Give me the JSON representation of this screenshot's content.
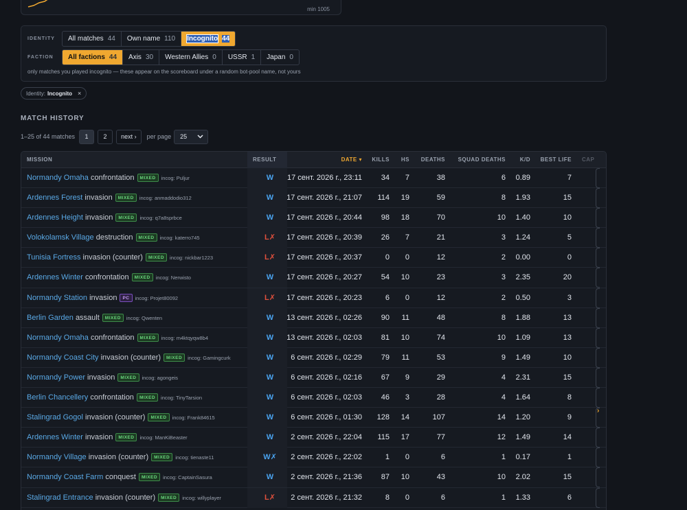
{
  "chart_card": {
    "min_label": "min 1005"
  },
  "filters": {
    "identity_label": "IDENTITY",
    "identity": [
      {
        "label": "All matches",
        "count": "44",
        "state": "normal"
      },
      {
        "label": "Own name",
        "count": "110",
        "state": "normal"
      },
      {
        "label": "Incognito",
        "count": "44",
        "state": "active"
      }
    ],
    "faction_label": "FACTION",
    "faction": [
      {
        "label": "All factions",
        "count": "44",
        "state": "active"
      },
      {
        "label": "Axis",
        "count": "30",
        "state": "normal"
      },
      {
        "label": "Western Allies",
        "count": "0",
        "state": "normal"
      },
      {
        "label": "USSR",
        "count": "1",
        "state": "normal"
      },
      {
        "label": "Japan",
        "count": "0",
        "state": "normal"
      }
    ],
    "note": "only matches you played incognito — these appear on the scoreboard under a random bot-pool name, not yours"
  },
  "chip": {
    "prefix": "Identity:",
    "value": "Incognito",
    "close": "×"
  },
  "history": {
    "title": "MATCH HISTORY",
    "count": "1–25 of 44 matches",
    "pages": [
      "1",
      "2"
    ],
    "next": "next ›",
    "per_page_label": "per page",
    "per_page_value": "25"
  },
  "table": {
    "headers": {
      "mission": "MISSION",
      "result": "RESULT",
      "date": "DATE ▾",
      "kills": "KILLS",
      "hs": "HS",
      "deaths": "DEATHS",
      "squad_deaths": "SQUAD DEATHS",
      "kd": "K/D",
      "best_life": "BEST LIFE",
      "cap": "CAP"
    },
    "rows": [
      {
        "map": "Normandy Omaha",
        "mode": "confrontation",
        "badge": "MIXED",
        "incog": "incog: Puljur",
        "result": "W",
        "date": "17 сент. 2026 г., 23:11",
        "kills": "34",
        "hs": "7",
        "deaths": "38",
        "squad": "6",
        "kd": "0.89",
        "best": "7"
      },
      {
        "map": "Ardennes Forest",
        "mode": "invasion",
        "badge": "MIXED",
        "incog": "incog: anmaddodio312",
        "result": "W",
        "date": "17 сент. 2026 г., 21:07",
        "kills": "114",
        "hs": "19",
        "deaths": "59",
        "squad": "8",
        "kd": "1.93",
        "best": "15"
      },
      {
        "map": "Ardennes Height",
        "mode": "invasion",
        "badge": "MIXED",
        "incog": "incog: q7a8sprbce",
        "result": "W",
        "date": "17 сент. 2026 г., 20:44",
        "kills": "98",
        "hs": "18",
        "deaths": "70",
        "squad": "10",
        "kd": "1.40",
        "best": "10"
      },
      {
        "map": "Volokolamsk Village",
        "mode": "destruction",
        "badge": "MIXED",
        "incog": "incog: katerro745",
        "result": "L✗",
        "date": "17 сент. 2026 г., 20:39",
        "kills": "26",
        "hs": "7",
        "deaths": "21",
        "squad": "3",
        "kd": "1.24",
        "best": "5"
      },
      {
        "map": "Tunisia Fortress",
        "mode": "invasion (counter)",
        "badge": "MIXED",
        "incog": "incog: nickbar1223",
        "result": "L✗",
        "date": "17 сент. 2026 г., 20:37",
        "kills": "0",
        "hs": "0",
        "deaths": "12",
        "squad": "2",
        "kd": "0.00",
        "best": "0"
      },
      {
        "map": "Ardennes Winter",
        "mode": "confrontation",
        "badge": "MIXED",
        "incog": "incog: Nerwisto",
        "result": "W",
        "date": "17 сент. 2026 г., 20:27",
        "kills": "54",
        "hs": "10",
        "deaths": "23",
        "squad": "3",
        "kd": "2.35",
        "best": "20"
      },
      {
        "map": "Normandy Station",
        "mode": "invasion",
        "badge": "PC",
        "incog": "incog: Projet80092",
        "result": "L✗",
        "date": "17 сент. 2026 г., 20:23",
        "kills": "6",
        "hs": "0",
        "deaths": "12",
        "squad": "2",
        "kd": "0.50",
        "best": "3"
      },
      {
        "map": "Berlin Garden",
        "mode": "assault",
        "badge": "MIXED",
        "incog": "incog: Qwenten",
        "result": "W",
        "date": "13 сент. 2026 г., 02:26",
        "kills": "90",
        "hs": "11",
        "deaths": "48",
        "squad": "8",
        "kd": "1.88",
        "best": "13"
      },
      {
        "map": "Normandy Omaha",
        "mode": "confrontation",
        "badge": "MIXED",
        "incog": "incog: m4ktqyqw8b4",
        "result": "W",
        "date": "13 сент. 2026 г., 02:03",
        "kills": "81",
        "hs": "10",
        "deaths": "74",
        "squad": "10",
        "kd": "1.09",
        "best": "13"
      },
      {
        "map": "Normandy Coast City",
        "mode": "invasion (counter)",
        "badge": "MIXED",
        "incog": "incog: Gamingcurk",
        "result": "W",
        "date": "6 сент. 2026 г., 02:29",
        "kills": "79",
        "hs": "11",
        "deaths": "53",
        "squad": "9",
        "kd": "1.49",
        "best": "10"
      },
      {
        "map": "Normandy Power",
        "mode": "invasion",
        "badge": "MIXED",
        "incog": "incog: agongeis",
        "result": "W",
        "date": "6 сент. 2026 г., 02:16",
        "kills": "67",
        "hs": "9",
        "deaths": "29",
        "squad": "4",
        "kd": "2.31",
        "best": "15"
      },
      {
        "map": "Berlin Chancellery",
        "mode": "confrontation",
        "badge": "MIXED",
        "incog": "incog: TinyTarsion",
        "result": "W",
        "date": "6 сент. 2026 г., 02:03",
        "kills": "46",
        "hs": "3",
        "deaths": "28",
        "squad": "4",
        "kd": "1.64",
        "best": "8"
      },
      {
        "map": "Stalingrad Gogol",
        "mode": "invasion (counter)",
        "badge": "MIXED",
        "incog": "incog: Frank84615",
        "result": "W",
        "date": "6 сент. 2026 г., 01:30",
        "kills": "128",
        "hs": "14",
        "deaths": "107",
        "squad": "14",
        "kd": "1.20",
        "best": "9"
      },
      {
        "map": "Ardennes Winter",
        "mode": "invasion",
        "badge": "MIXED",
        "incog": "incog: ManKiBeaster",
        "result": "W",
        "date": "2 сент. 2026 г., 22:04",
        "kills": "115",
        "hs": "17",
        "deaths": "77",
        "squad": "12",
        "kd": "1.49",
        "best": "14"
      },
      {
        "map": "Normandy Village",
        "mode": "invasion (counter)",
        "badge": "MIXED",
        "incog": "incog: tienaste11",
        "result": "W✗",
        "date": "2 сент. 2026 г., 22:02",
        "kills": "1",
        "hs": "0",
        "deaths": "6",
        "squad": "1",
        "kd": "0.17",
        "best": "1"
      },
      {
        "map": "Normandy Coast Farm",
        "mode": "conquest",
        "badge": "MIXED",
        "incog": "incog: CaptainSasura",
        "result": "W",
        "date": "2 сент. 2026 г., 21:36",
        "kills": "87",
        "hs": "10",
        "deaths": "43",
        "squad": "10",
        "kd": "2.02",
        "best": "15"
      },
      {
        "map": "Stalingrad Entrance",
        "mode": "invasion (counter)",
        "badge": "MIXED",
        "incog": "incog: willyplayer",
        "result": "L✗",
        "date": "2 сент. 2026 г., 21:32",
        "kills": "8",
        "hs": "0",
        "deaths": "6",
        "squad": "1",
        "kd": "1.33",
        "best": "6"
      }
    ]
  },
  "colors": {
    "accent": "#f0a830",
    "link": "#5aa9e6",
    "win": "#4aa3ef",
    "loss": "#e0503d",
    "badge_mixed": "#6ad67e",
    "badge_pc": "#c39af2"
  }
}
